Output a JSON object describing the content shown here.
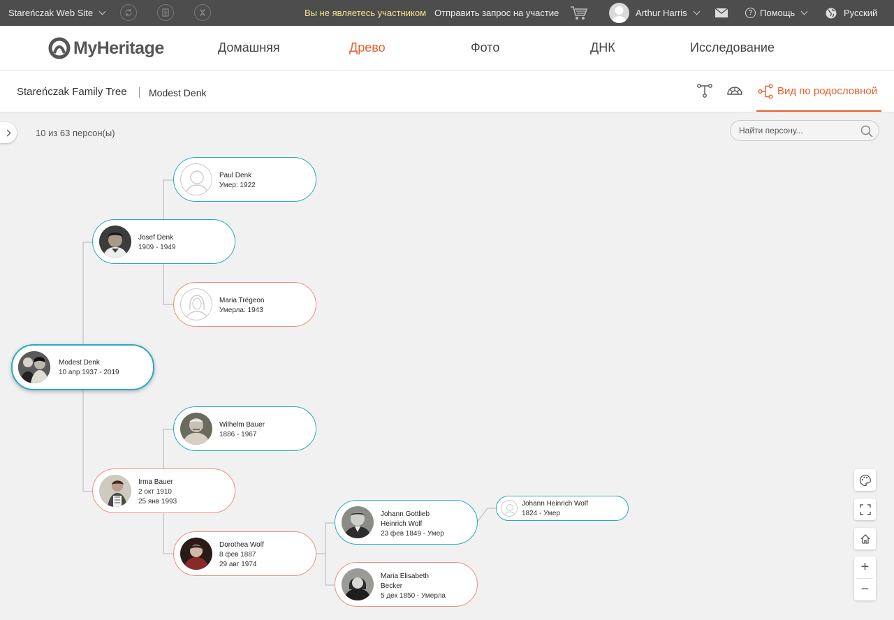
{
  "topbar": {
    "site_name": "Stareńczak Web Site",
    "not_member": "Вы не являетесь участником",
    "request": "Отправить запрос на участие",
    "user": "Arthur Harris",
    "help": "Помощь",
    "language": "Русский",
    "colors": {
      "bg": "#4d4d4d",
      "notice": "#f5e58a"
    }
  },
  "nav": {
    "logo": "MyHeritage",
    "items": [
      "Домашняя",
      "Древо",
      "Фото",
      "ДНК",
      "Исследование"
    ],
    "active": "Древо",
    "accent": "#e8602c"
  },
  "breadcrumb": {
    "tree": "Stareńczak Family Tree",
    "person": "Modest Denk"
  },
  "views": {
    "pedigree_label": "Вид по родословной"
  },
  "toolbar": {
    "count": "10 из 63 персон(ы)",
    "search_placeholder": "Найти персону..."
  },
  "people": {
    "modest": {
      "name": "Modest Denk",
      "line1": "10 апр 1937 - 2019"
    },
    "josef": {
      "name": "Josef Denk",
      "line1": "1909 - 1949"
    },
    "paul": {
      "name": "Paul Denk",
      "line1": "Умер: 1922"
    },
    "maria_t": {
      "name": "Maria Trégeon",
      "line1": "Умерла: 1943"
    },
    "irma": {
      "name": "Irma Bauer",
      "line1": "2 окт 1910",
      "line2": "25 янв 1993"
    },
    "wilhelm": {
      "name": "Wilhelm Bauer",
      "line1": "1886 - 1967"
    },
    "dorothea": {
      "name": "Dorothea Wolf",
      "line1": "8 фев 1887",
      "line2": "29 авг 1974"
    },
    "johann_g": {
      "name1": "Johann Gottlieb",
      "name2": "Heinrich Wolf",
      "line1": "23 фев 1849 - Умер"
    },
    "maria_e": {
      "name1": "Maria Elisabeth",
      "name2": "Becker",
      "line1": "5 дек 1850 - Умерла"
    },
    "johann_h": {
      "name": "Johann Heinrich Wolf",
      "line1": "1824 - Умер"
    }
  },
  "colors": {
    "male_border": "#2aaabf",
    "female_border": "#ef8f82",
    "connector": "#b5b5b5"
  },
  "zoom": {
    "plus": "+",
    "minus": "−"
  }
}
